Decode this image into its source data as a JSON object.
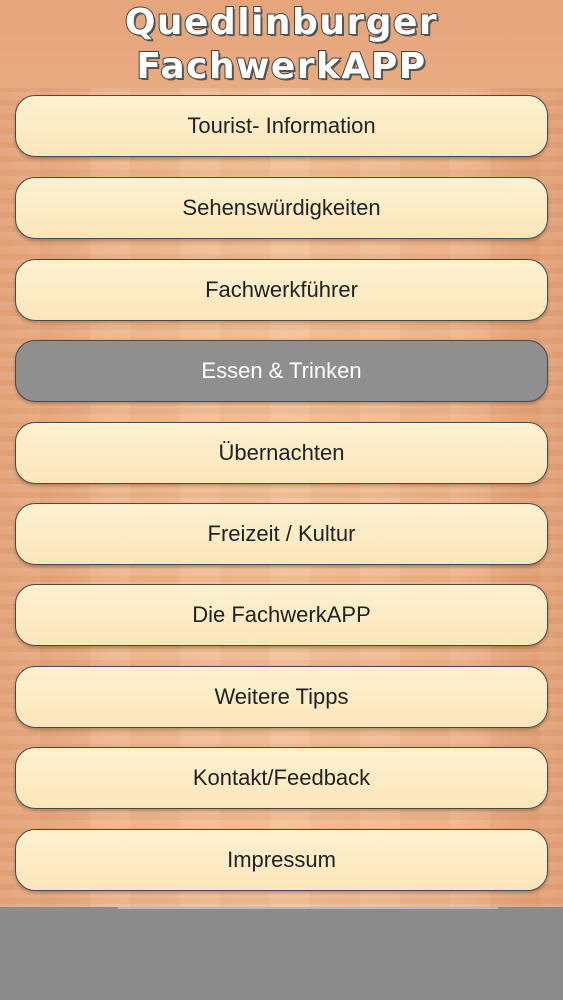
{
  "app": {
    "title_line1": "Quedlinburger",
    "title_line2": "FachwerkAPP"
  },
  "menu": {
    "items": [
      {
        "label": "Tourist- Information",
        "active": false
      },
      {
        "label": "Sehenswürdigkeiten",
        "active": false
      },
      {
        "label": "Fachwerkführer",
        "active": false
      },
      {
        "label": "Essen & Trinken",
        "active": true
      },
      {
        "label": "Übernachten",
        "active": false
      },
      {
        "label": "Freizeit / Kultur",
        "active": false
      },
      {
        "label": "Die FachwerkAPP",
        "active": false
      },
      {
        "label": "Weitere Tipps",
        "active": false
      },
      {
        "label": "Kontakt/Feedback",
        "active": false
      },
      {
        "label": "Impressum",
        "active": false
      }
    ]
  },
  "colors": {
    "button_bg": "#fbe9c2",
    "button_active_bg": "#8f8f8f",
    "wood": "#f0b98f",
    "bottom_bar": "#8c8c8c"
  }
}
